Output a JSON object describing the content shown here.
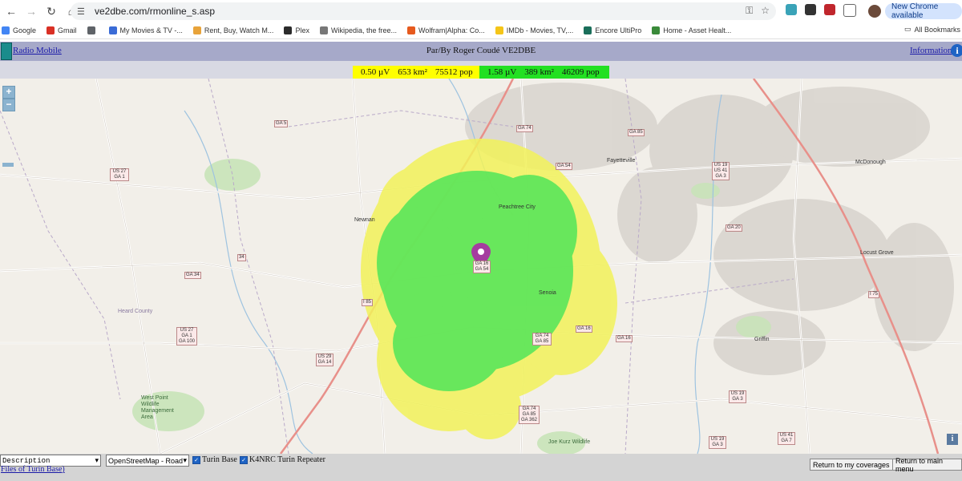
{
  "browser": {
    "url": "ve2dbe.com/rmonline_s.asp",
    "new_chrome": "New Chrome available",
    "bookmarks": [
      {
        "label": "Google",
        "color": "#4285f4"
      },
      {
        "label": "Gmail",
        "color": "#d93025"
      },
      {
        "label": "",
        "color": "#5f6368"
      },
      {
        "label": "My Movies & TV -...",
        "color": "#3a6bd6"
      },
      {
        "label": "Rent, Buy, Watch M...",
        "color": "#e8a33a"
      },
      {
        "label": "Plex",
        "color": "#2b2b2b"
      },
      {
        "label": "Wikipedia, the free...",
        "color": "#777"
      },
      {
        "label": "Wolfram|Alpha: Co...",
        "color": "#e65a1e"
      },
      {
        "label": "IMDb - Movies, TV,...",
        "color": "#f5c518"
      },
      {
        "label": "Encore UltiPro",
        "color": "#1a6e5a"
      },
      {
        "label": "Home - Asset Healt...",
        "color": "#3a8a3a"
      }
    ],
    "all_bookmarks": "All Bookmarks"
  },
  "header": {
    "app_link": "Radio Mobile",
    "title": "Par/By Roger Coudé VE2DBE",
    "info_link": "Information"
  },
  "legend": {
    "yellow": {
      "uv": "0.50 µV",
      "km": "653 km²",
      "pop": "75512 pop",
      "color": "#ffff00"
    },
    "green": {
      "uv": "1.58 µV",
      "km": "389 km²",
      "pop": "46209 pop",
      "color": "#22e022"
    }
  },
  "map": {
    "cities": [
      "Newnan",
      "Peachtree City",
      "Fayetteville",
      "McDonough",
      "Locust Grove",
      "Senoia",
      "Griffin",
      "Heard County",
      "West Point Wildlife Management Area",
      "Joe Kurz Wildlife"
    ],
    "shields": [
      "GA 5",
      "GA 74",
      "GA 85",
      "US 27 GA 1",
      "GA 54",
      "GA 34",
      "34",
      "I 85",
      "US 19 US 41 GA 3",
      "GA 20",
      "I 75",
      "US 27 GA 1 GA 100",
      "US 29 GA 14",
      "GA 16",
      "GA 16",
      "GA 74 GA 85",
      "GA 16 GA 54",
      "US 19 GA 3",
      "GA 74 GA 85 GA 362",
      "US 19 GA 3",
      "US 41 GA 7"
    ],
    "marker_label": "GA 16 GA 54"
  },
  "bottom": {
    "description_select": "Description",
    "map_select": "OpenStreetMap - Road",
    "check1": "Turin Base",
    "check2": "K4NRC Turin Repeater",
    "files_link": "Files of Turin Base",
    "return_coverages": "Return to my coverages",
    "return_menu": "Return to main menu"
  }
}
